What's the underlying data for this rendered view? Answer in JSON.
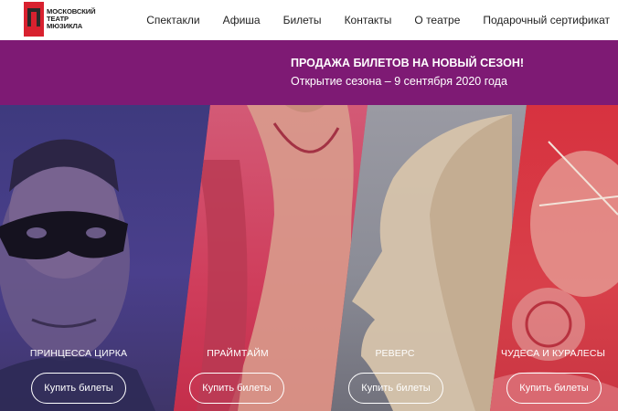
{
  "logo": {
    "line1": "МОСКОВСКИЙ",
    "line2": "ТЕАТР",
    "line3": "МЮЗИКЛА"
  },
  "nav": {
    "items": [
      {
        "label": "Спектакли"
      },
      {
        "label": "Афиша"
      },
      {
        "label": "Билеты"
      },
      {
        "label": "Контакты"
      },
      {
        "label": "О театре"
      },
      {
        "label": "Подарочный сертификат"
      }
    ]
  },
  "banner": {
    "title": "ПРОДАЖА БИЛЕТОВ НА НОВЫЙ СЕЗОН!",
    "subtitle": "Открытие сезона – 9 сентября 2020 года"
  },
  "shows": [
    {
      "title": "ПРИНЦЕССА ЦИРКА",
      "button": "Купить билеты"
    },
    {
      "title": "ПРАЙМТАЙМ",
      "button": "Купить билеты"
    },
    {
      "title": "РЕВЕРС",
      "button": "Купить билеты"
    },
    {
      "title": "ЧУДЕСА И КУРАЛЕСЫ",
      "button": "Купить билеты"
    }
  ],
  "colors": {
    "brand_red": "#d8212f",
    "banner_purple": "#7e1a74",
    "panel_1": "#3e3a7e",
    "panel_2": "#cf3d5b",
    "panel_3": "#8b8c96",
    "panel_4": "#d7323f"
  }
}
